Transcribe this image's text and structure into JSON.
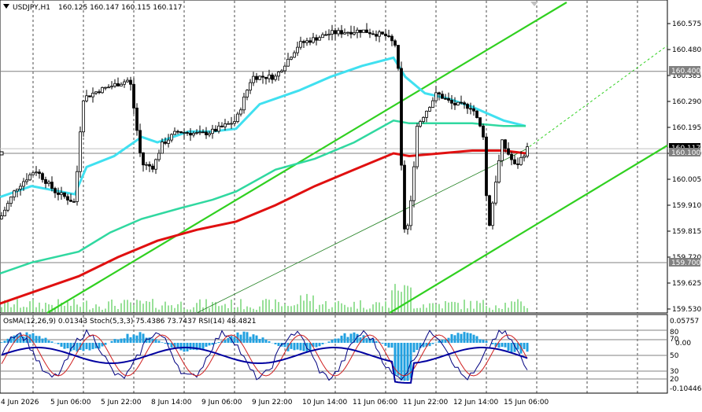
{
  "header": {
    "symbol_tf": "USDJPY,H1",
    "quotes": "160.125 160.147 160.115 160.117"
  },
  "price_axis": [
    "160.575",
    "160.480",
    "160.385",
    "160.290",
    "160.195",
    "160.100",
    "160.005",
    "159.910",
    "159.815",
    "159.720",
    "159.625",
    "159.530"
  ],
  "levels": {
    "upper": "160.400",
    "current": "160.117",
    "mid": "160.100",
    "lower": "159.700"
  },
  "indicator": {
    "title": "OsMA(12,26,9) 0.01343  Stoch(5,3,3) 75.4386 73.7437  RSI(14) 48.4821",
    "axis": [
      "0.05757",
      "80",
      "0.00",
      "70",
      "50",
      "30",
      "20",
      "-0.10446"
    ]
  },
  "time_axis": [
    "4 Jun 2026",
    "5 Jun 06:00",
    "5 Jun 22:00",
    "8 Jun 14:00",
    "9 Jun 06:00",
    "9 Jun 22:00",
    "10 Jun 14:00",
    "11 Jun 06:00",
    "11 Jun 22:00",
    "12 Jun 14:00",
    "15 Jun 06:00"
  ],
  "colors": {
    "background": "#ffffff",
    "candles": "#000000",
    "ma_fast": "#40e0f0",
    "ma_mid": "#30d8a0",
    "ma_slow": "#e01010",
    "channel": "#30d020",
    "osma": "#20a0e0",
    "stoch_main": "#000080",
    "stoch_signal": "#d02020",
    "rsi": "#0000a0"
  },
  "icons": [
    "menu-triangle-icon",
    "scroll-marker-icon"
  ]
}
